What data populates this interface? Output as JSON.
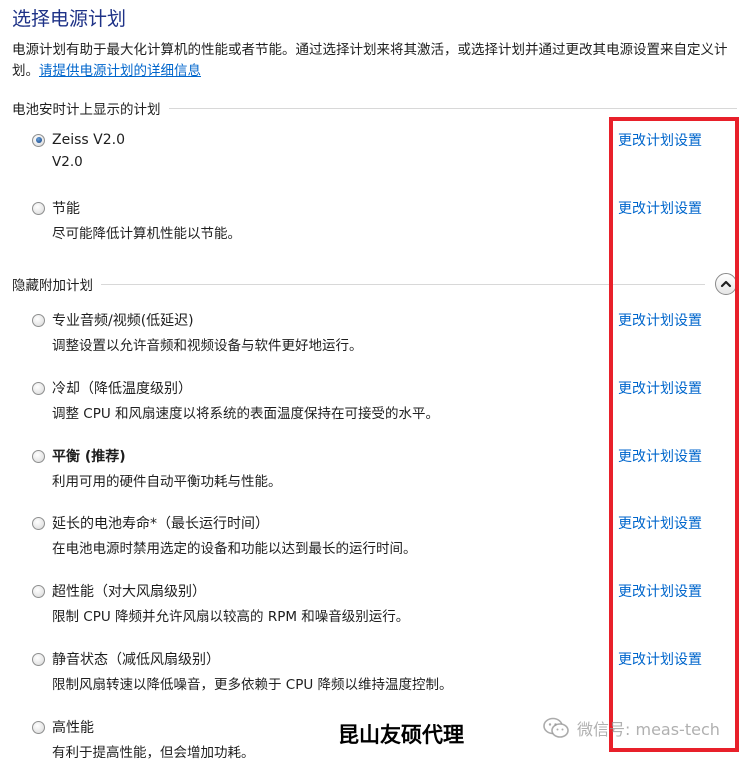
{
  "header": {
    "title": "选择电源计划",
    "description": "电源计划有助于最大化计算机的性能或者节能。通过选择计划来将其激活，或选择计划并通过更改其电源设置来自定义计划。",
    "info_link": "请提供电源计划的详细信息"
  },
  "battery_group": {
    "label": "电池安时计上显示的计划",
    "plans": [
      {
        "name": "Zeiss V2.0",
        "desc": "V2.0",
        "selected": true,
        "bold": false,
        "change": "更改计划设置"
      },
      {
        "name": "节能",
        "desc": "尽可能降低计算机性能以节能。",
        "selected": false,
        "bold": false,
        "change": "更改计划设置"
      }
    ]
  },
  "hidden_group": {
    "label": "隐藏附加计划",
    "collapse_icon": "chevron-up-icon",
    "plans": [
      {
        "name": "专业音频/视频(低延迟)",
        "desc": "调整设置以允许音频和视频设备与软件更好地运行。",
        "selected": false,
        "bold": false,
        "change": "更改计划设置"
      },
      {
        "name": "冷却（降低温度级别）",
        "desc": "调整 CPU 和风扇速度以将系统的表面温度保持在可接受的水平。",
        "selected": false,
        "bold": false,
        "change": "更改计划设置"
      },
      {
        "name": "平衡 (推荐)",
        "desc": "利用可用的硬件自动平衡功耗与性能。",
        "selected": false,
        "bold": true,
        "change": "更改计划设置"
      },
      {
        "name": "延长的电池寿命*（最长运行时间）",
        "desc": "在电池电源时禁用选定的设备和功能以达到最长的运行时间。",
        "selected": false,
        "bold": false,
        "change": "更改计划设置"
      },
      {
        "name": "超性能（对大风扇级别）",
        "desc": "限制 CPU 降频并允许风扇以较高的 RPM 和噪音级别运行。",
        "selected": false,
        "bold": false,
        "change": "更改计划设置"
      },
      {
        "name": "静音状态（减低风扇级别）",
        "desc": "限制风扇转速以降低噪音，更多依赖于 CPU 降频以维持温度控制。",
        "selected": false,
        "bold": false,
        "change": "更改计划设置"
      },
      {
        "name": "高性能",
        "desc": "有利于提高性能，但会增加功耗。",
        "selected": false,
        "bold": false,
        "change": ""
      }
    ]
  },
  "overlay": {
    "highlight_color": "#e8202a",
    "watermark_text": "昆山友硕代理",
    "wechat_text": "微信号: meas-tech",
    "wechat_icon": "wechat-icon"
  }
}
